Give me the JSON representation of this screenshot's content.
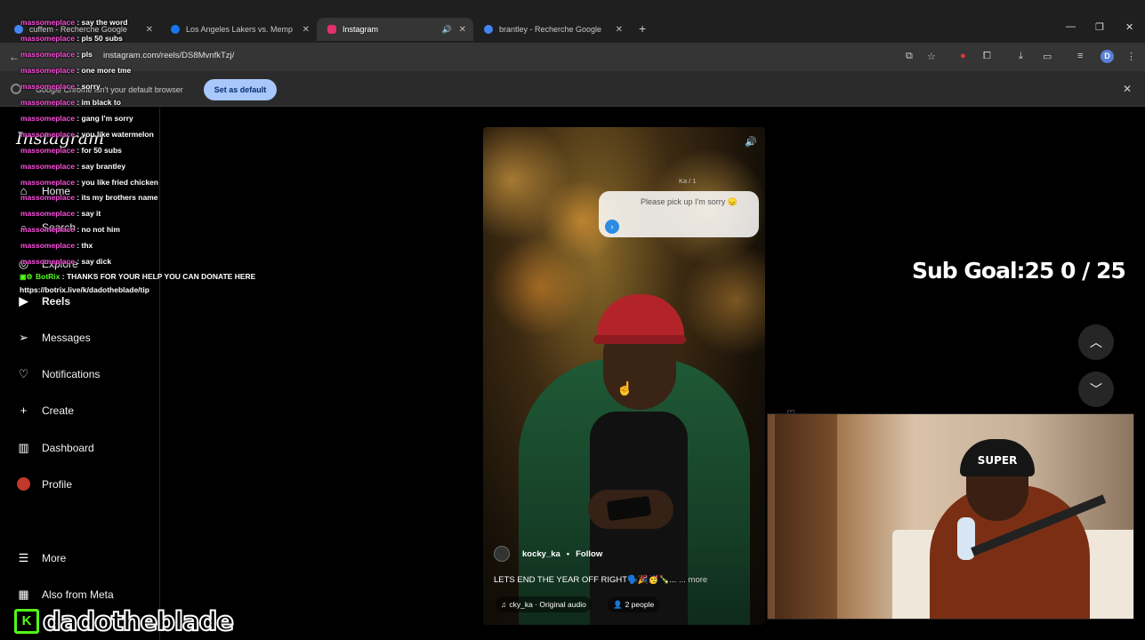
{
  "browser": {
    "tabs": [
      {
        "title": "cuffem - Recherche Google",
        "icon": "google-icon",
        "color": "#4285f4"
      },
      {
        "title": "Los Angeles Lakers vs. Memphi",
        "icon": "facebook-icon",
        "color": "#1877f2"
      },
      {
        "title": "Instagram",
        "icon": "instagram-icon",
        "color": "#e1306c"
      },
      {
        "title": "brantley - Recherche Google",
        "icon": "google-icon",
        "color": "#4285f4"
      }
    ],
    "url": "instagram.com/reels/DS8MvnfkTzj/",
    "profile_initial": "D",
    "infobar_text": "Google Chrome isn't your default browser",
    "set_default_label": "Set as default"
  },
  "instagram": {
    "logo": "Instagram",
    "nav": [
      {
        "label": "Home",
        "icon": "home-icon"
      },
      {
        "label": "Search",
        "icon": "search-icon"
      },
      {
        "label": "Explore",
        "icon": "compass-icon"
      },
      {
        "label": "Reels",
        "icon": "reels-icon"
      },
      {
        "label": "Messages",
        "icon": "messages-icon"
      },
      {
        "label": "Notifications",
        "icon": "heart-icon"
      },
      {
        "label": "Create",
        "icon": "plus-icon"
      },
      {
        "label": "Dashboard",
        "icon": "dashboard-icon"
      },
      {
        "label": "Profile",
        "icon": "profile-avatar-icon"
      }
    ],
    "more_label": "More",
    "meta_label": "Also from Meta"
  },
  "reel": {
    "overlay_label": "Ka / 1",
    "message_text": "Please pick up I'm sorry 😞",
    "author": "kocky_ka",
    "follow_label": "Follow",
    "caption": "LETS END THE YEAR OFF RIGHT🗣️🎉🥳🍾...",
    "caption_more": "... more",
    "audio": "cky_ka · Original audio",
    "people": "2 people"
  },
  "chat": {
    "messages": [
      {
        "user": "massomeplace",
        "text": "say the word"
      },
      {
        "user": "massomeplace",
        "text": "pls 50 subs"
      },
      {
        "user": "massomeplace",
        "text": "pls"
      },
      {
        "user": "massomeplace",
        "text": "one more tme"
      },
      {
        "user": "massomeplace",
        "text": "sorry"
      },
      {
        "user": "massomeplace",
        "text": "im black to"
      },
      {
        "user": "massomeplace",
        "text": "gang I'm sorry"
      },
      {
        "user": "massomeplace",
        "text": "you like watermelon"
      },
      {
        "user": "massomeplace",
        "text": "for 50 subs"
      },
      {
        "user": "massomeplace",
        "text": "say brantley"
      },
      {
        "user": "massomeplace",
        "text": "you like fried chicken"
      },
      {
        "user": "massomeplace",
        "text": "its my brothers name"
      },
      {
        "user": "massomeplace",
        "text": "say it"
      },
      {
        "user": "massomeplace",
        "text": "no not him"
      },
      {
        "user": "massomeplace",
        "text": "thx"
      },
      {
        "user": "massomeplace",
        "text": "say dick"
      }
    ],
    "bot": {
      "user": "BotRix",
      "text": "THANKS FOR YOUR HELP YOU CAN DONATE HERE",
      "link": "https://botrix.live/k/dadotheblade/tip"
    }
  },
  "stream": {
    "sub_goal": "Sub Goal:25  0 / 25",
    "channel": "dadotheblade",
    "webcam_beanie": "SUPER"
  }
}
